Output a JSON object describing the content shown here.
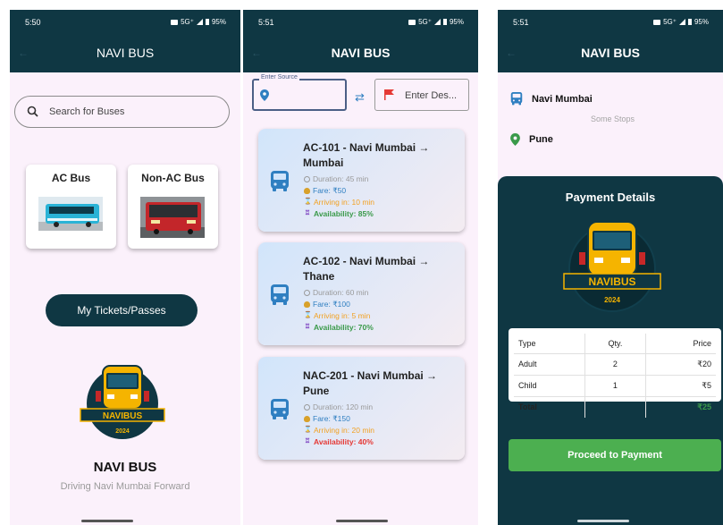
{
  "screens": [
    {
      "status": {
        "time": "5:50",
        "network": "5G⁺",
        "battery": "95%"
      },
      "appbar": {
        "title": "NAVI BUS"
      },
      "search": {
        "placeholder": "Search for Buses"
      },
      "bus_types": [
        {
          "label": "AC Bus"
        },
        {
          "label": "Non-AC Bus"
        }
      ],
      "tickets_button": "My Tickets/Passes",
      "brand": {
        "name": "NAVI BUS",
        "tagline": "Driving Navi Mumbai Forward"
      }
    },
    {
      "status": {
        "time": "5:51",
        "network": "5G⁺",
        "battery": "95%"
      },
      "appbar": {
        "title": "NAVI BUS"
      },
      "source": {
        "legend": "Enter Source",
        "value": ""
      },
      "destination": {
        "placeholder": "Enter Des..."
      },
      "routes": [
        {
          "title": "AC-101 - Navi Mumbai → Mumbai",
          "duration": "Duration: 45 min",
          "fare": "Fare: ₹50",
          "arriving": "Arriving in: 10 min",
          "availability": "Availability: 85%",
          "availability_color": "#3a9a4a"
        },
        {
          "title": "AC-102 - Navi Mumbai → Thane",
          "duration": "Duration: 60 min",
          "fare": "Fare: ₹100",
          "arriving": "Arriving in: 5 min",
          "availability": "Availability: 70%",
          "availability_color": "#3a9a4a"
        },
        {
          "title": "NAC-201 - Navi Mumbai → Pune",
          "duration": "Duration: 120 min",
          "fare": "Fare: ₹150",
          "arriving": "Arriving in: 20 min",
          "availability": "Availability: 40%",
          "availability_color": "#e53935"
        }
      ]
    },
    {
      "status": {
        "time": "5:51",
        "network": "5G⁺",
        "battery": "95%"
      },
      "appbar": {
        "title": "NAVI BUS"
      },
      "trip": {
        "from": "Navi Mumbai",
        "via": "Some Stops",
        "to": "Pune"
      },
      "payment": {
        "title": "Payment Details",
        "headers": [
          "Type",
          "Qty.",
          "Price"
        ],
        "rows": [
          {
            "type": "Adult",
            "qty": "2",
            "price": "₹20"
          },
          {
            "type": "Child",
            "qty": "1",
            "price": "₹5"
          }
        ],
        "total": {
          "label": "Total",
          "qty": "",
          "price": "₹25"
        },
        "button": "Proceed to Payment"
      }
    }
  ],
  "logo": {
    "text": "NAVIBUS",
    "year": "2024"
  },
  "colors": {
    "primary": "#0f3743",
    "accent_green": "#4caf50",
    "page_bg": "#fbf1fb",
    "bus_yellow": "#f5b400"
  },
  "icons": [
    "back-arrow-icon",
    "search-icon",
    "location-pin-icon",
    "swap-icon",
    "flag-icon",
    "bus-icon",
    "clock-icon",
    "money-bag-icon",
    "hourglass-icon",
    "seat-icon"
  ]
}
